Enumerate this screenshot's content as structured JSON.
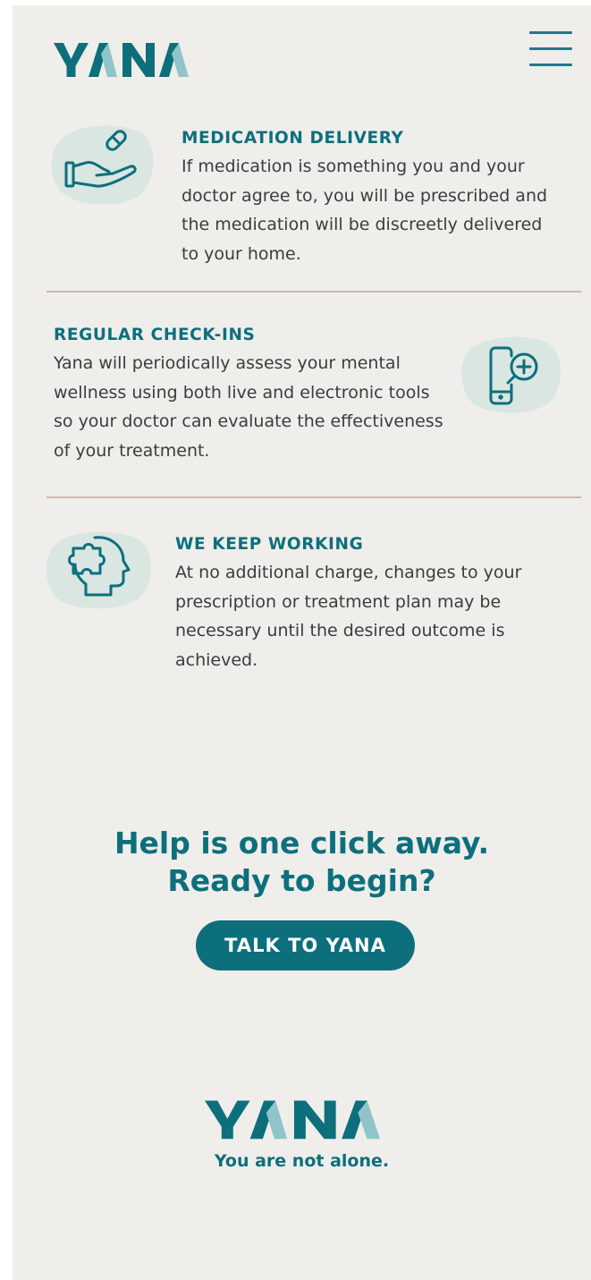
{
  "header": {
    "logo_text": "YANA",
    "menu_icon": "hamburger-menu-icon"
  },
  "features": [
    {
      "title": "MEDICATION DELIVERY",
      "text": "If medication is something you and your doctor agree to, you will be prescribed and the medication will be discreetly delivered to your home.",
      "icon": "hand-pill-icon"
    },
    {
      "title": "REGULAR CHECK-INS",
      "text": "Yana will periodically assess your mental wellness using both live and electronic tools so your doctor can evaluate the effectiveness of your treatment.",
      "icon": "phone-plus-icon"
    },
    {
      "title": "WE KEEP WORKING",
      "text": "At no additional charge, changes to your prescription or  treatment plan may be necessary until the desired outcome is achieved.",
      "icon": "head-puzzle-icon"
    }
  ],
  "cta": {
    "heading_line1": "Help is one click away.",
    "heading_line2": "Ready to begin?",
    "button_label": "TALK TO YANA"
  },
  "footer": {
    "logo_text": "YANA",
    "tagline": "You are not alone."
  },
  "colors": {
    "brand_teal": "#0d6f7c",
    "accent_light_teal": "#8fc5c9",
    "blob": "#d9e6e2",
    "background": "#efeeeb",
    "divider": "#cdb9aa"
  }
}
